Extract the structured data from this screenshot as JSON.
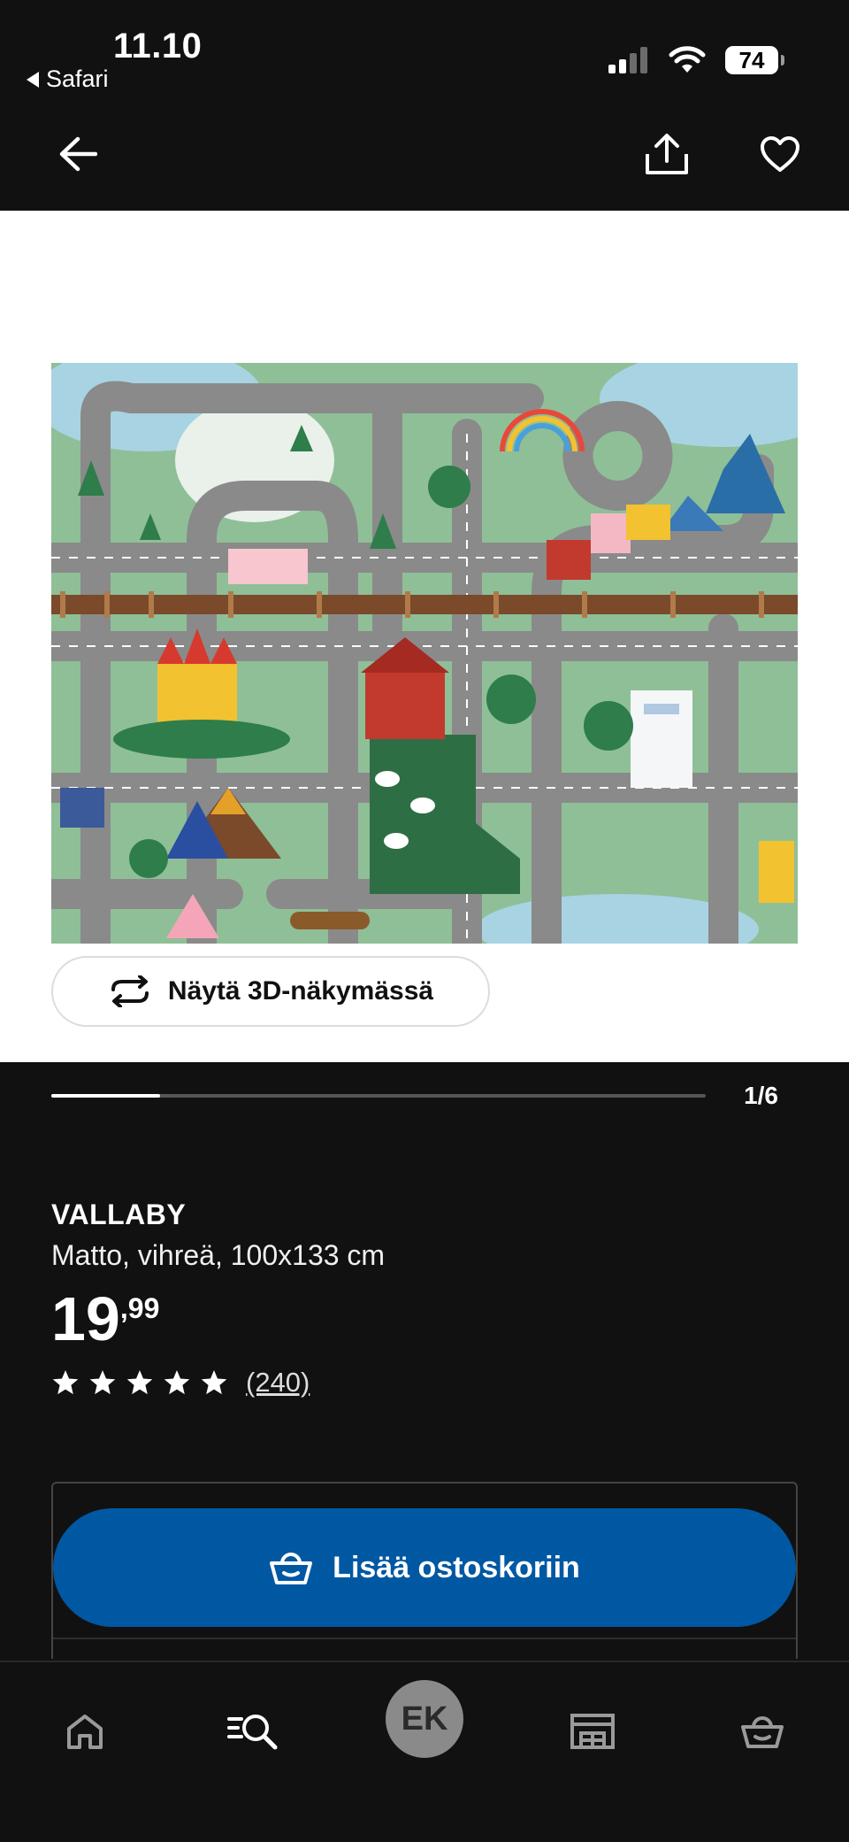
{
  "status_bar": {
    "time": "11.10",
    "back_app": "Safari",
    "battery": "74",
    "icons": [
      "cellular-signal-icon",
      "wifi-icon",
      "battery-icon"
    ]
  },
  "header": {
    "back_icon": "arrow-left-icon",
    "share_icon": "share-icon",
    "favourite_icon": "heart-icon"
  },
  "gallery": {
    "view_3d_label": "Näytä 3D-näkymässä",
    "page_indicator": "1/6",
    "current_image": 1,
    "total_images": 6
  },
  "product": {
    "name": "VALLABY",
    "description": "Matto, vihreä, 100x133 cm",
    "price_integer": "19",
    "price_decimal": ",99",
    "rating": 5,
    "review_count": "(240)"
  },
  "cart": {
    "add_label": "Lisää ostoskoriin",
    "button_color": "#0058a3"
  },
  "tab_bar": {
    "items": [
      "home-icon",
      "search-icon",
      "profile-avatar",
      "store-icon",
      "cart-icon"
    ],
    "avatar_initials": "EK"
  }
}
